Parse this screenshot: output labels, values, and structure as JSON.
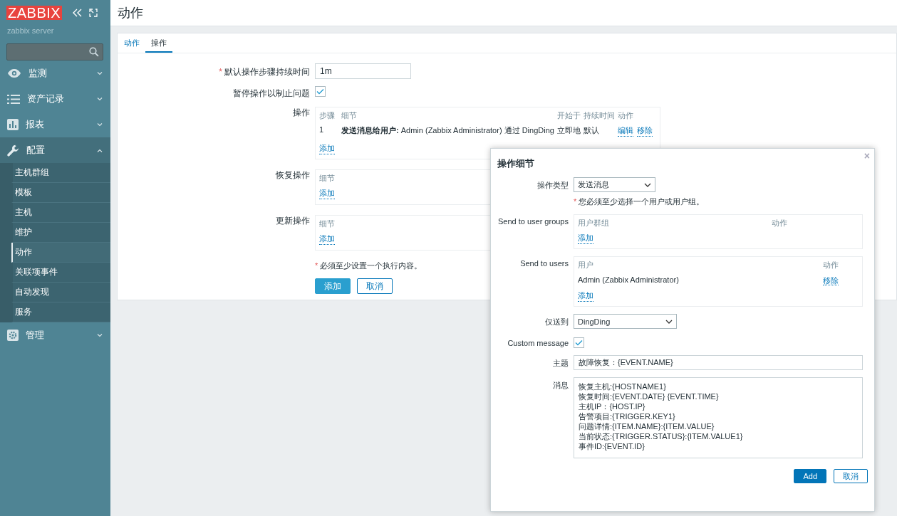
{
  "sidebar": {
    "logo": "ZABBIX",
    "server": "zabbix server",
    "menu": [
      {
        "label": "监测",
        "expanded": false
      },
      {
        "label": "资产记录",
        "expanded": false
      },
      {
        "label": "报表",
        "expanded": false
      },
      {
        "label": "配置",
        "expanded": true,
        "children": [
          {
            "label": "主机群组",
            "selected": false
          },
          {
            "label": "模板",
            "selected": false
          },
          {
            "label": "主机",
            "selected": false
          },
          {
            "label": "维护",
            "selected": false
          },
          {
            "label": "动作",
            "selected": true
          },
          {
            "label": "关联项事件",
            "selected": false
          },
          {
            "label": "自动发现",
            "selected": false
          },
          {
            "label": "服务",
            "selected": false
          }
        ]
      },
      {
        "label": "管理",
        "expanded": false
      }
    ]
  },
  "page_title": "动作",
  "tabs": [
    {
      "label": "动作",
      "selected": false
    },
    {
      "label": "操作",
      "selected": true
    }
  ],
  "form": {
    "duration": {
      "mark": "*",
      "label": "默认操作步骤持续时间",
      "value": "1m"
    },
    "pause": {
      "label": "暂停操作以制止问题",
      "checked": true
    },
    "operations": {
      "label": "操作",
      "columns": [
        "步骤",
        "细节",
        "开始于",
        "持续时间",
        "动作"
      ],
      "rows": [
        {
          "step": "1",
          "detail": "**发送消息给用户:** Admin (Zabbix Administrator) 通过 DingDing",
          "start": "立即地",
          "duration": "默认",
          "actions": [
            "编辑",
            "移除"
          ]
        }
      ],
      "add": "添加"
    },
    "recovery": {
      "label": "恢复操作",
      "column": "细节",
      "add": "添加"
    },
    "update": {
      "label": "更新操作",
      "column": "细节",
      "add": "添加"
    },
    "note": {
      "mark": "*",
      "text": "必须至少设置一个执行内容。"
    },
    "buttons": [
      {
        "label": "添加",
        "kind": "primary"
      },
      {
        "label": "取消",
        "kind": "secondary"
      }
    ]
  },
  "modal": {
    "title": "操作细节",
    "close": "×",
    "op_type": {
      "label": "操作类型",
      "value": "发送消息"
    },
    "note": {
      "mark": "*",
      "text": "您必须至少选择一个用户或用户组。"
    },
    "groups": {
      "label": "Send to user groups",
      "columns": [
        "用户群组",
        "动作"
      ],
      "add": "添加"
    },
    "users": {
      "label": "Send to users",
      "columns": [
        "用户",
        "动作"
      ],
      "rows": [
        {
          "name": "Admin (Zabbix Administrator)",
          "action": "移除"
        }
      ],
      "add": "添加"
    },
    "send_only": {
      "label": "仅送到",
      "value": "DingDing"
    },
    "custom": {
      "label": "Custom message",
      "checked": true
    },
    "subject": {
      "label": "主题",
      "value": "故障恢复：{EVENT.NAME}"
    },
    "message": {
      "label": "消息",
      "lines": [
        "恢复主机:{HOSTNAME1}",
        "恢复时间:{EVENT.DATE} {EVENT.TIME}",
        "主机IP：{HOST.IP}",
        "告警项目:{TRIGGER.KEY1}",
        "问题详情:{ITEM.NAME}:{ITEM.VALUE}",
        "当前状态:{TRIGGER.STATUS}:{ITEM.VALUE1}",
        "事件ID:{EVENT.ID}"
      ]
    },
    "buttons": [
      {
        "label": "Add",
        "kind": "primary"
      },
      {
        "label": "取消",
        "kind": "secondary"
      }
    ]
  }
}
